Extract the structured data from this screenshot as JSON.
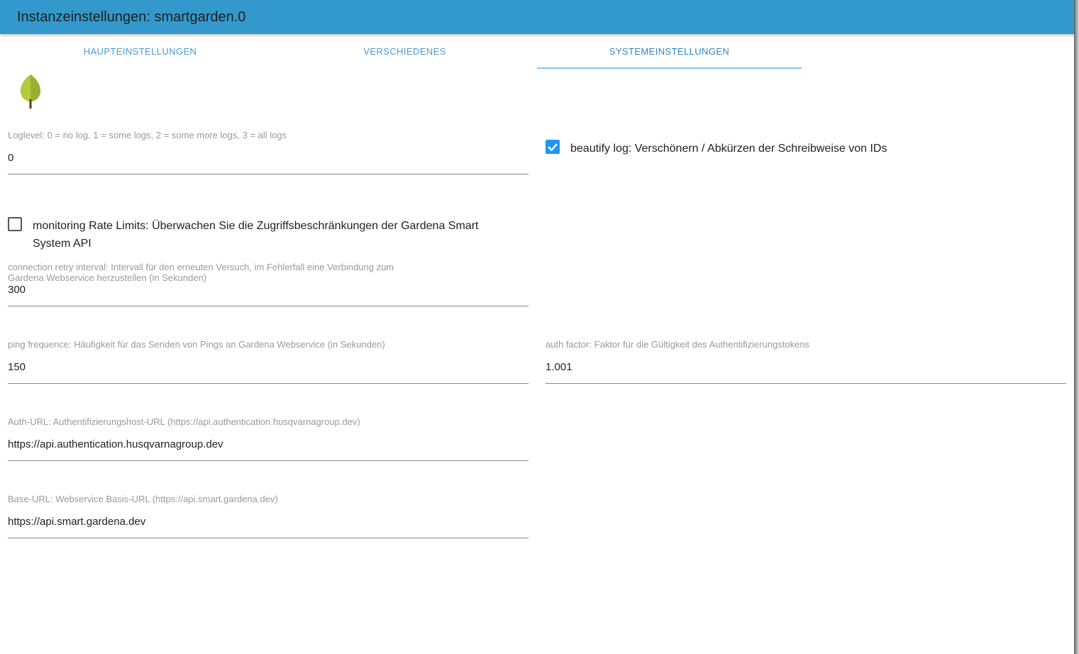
{
  "window": {
    "title": "Instanzeinstellungen: smartgarden.0"
  },
  "tabs": [
    {
      "label": "HAUPTEINSTELLUNGEN",
      "active": false
    },
    {
      "label": "VERSCHIEDENES",
      "active": false
    },
    {
      "label": "SYSTEMEINSTELLUNGEN",
      "active": true
    }
  ],
  "logo": {
    "icon": "leaf-tree-icon"
  },
  "settings": {
    "loglevel": {
      "label": "Loglevel: 0 = no log, 1 = some logs, 2 = some more logs, 3 = all logs",
      "value": "0"
    },
    "beautify_log": {
      "label": "beautify log: Verschönern / Abkürzen der Schreibweise von IDs",
      "checked": true
    },
    "monitoring_rate_limits": {
      "label_line1": "monitoring Rate Limits: Überwachen Sie die Zugriffsbeschränkungen der Gardena Smart",
      "label_line2": "System API",
      "checked": false
    },
    "connection_retry_interval": {
      "label_line1": "connection retry interval: Intervall für den erneuten Versuch, im Fehlerfall eine Verbindung zum",
      "label_line2": "Gardena Webservice herzustellen (in Sekunden)",
      "value": "300"
    },
    "ping_frequence": {
      "label": "ping frequence: Häufigkeit für das Senden von Pings an Gardena Webservice (in Sekunden)",
      "value": "150"
    },
    "auth_factor": {
      "label": "auth factor: Faktor für die Gültigkeit des Authentifizierungstokens",
      "value": "1.001"
    },
    "auth_url": {
      "label": "Auth-URL: Authentifizierungshost-URL (https://api.authentication.husqvarnagroup.dev)",
      "value": "https://api.authentication.husqvarnagroup.dev"
    },
    "base_url": {
      "label": "Base-URL: Webservice Basis-URL (https://api.smart.gardena.dev)",
      "value": "https://api.smart.gardena.dev"
    }
  },
  "colors": {
    "titlebar": "#3399cc",
    "tab_text": "#4a9bd5",
    "checkbox_checked": "#2196f3"
  }
}
